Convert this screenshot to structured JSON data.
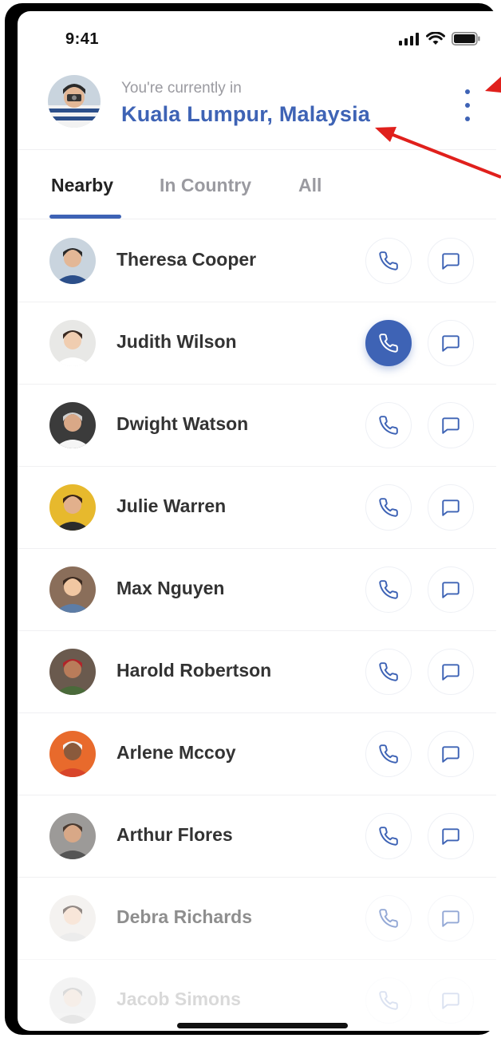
{
  "status": {
    "time": "9:41"
  },
  "header": {
    "subtitle": "You're currently in",
    "location": "Kuala Lumpur, Malaysia"
  },
  "tabs": [
    {
      "label": "Nearby",
      "active": true
    },
    {
      "label": "In Country",
      "active": false
    },
    {
      "label": "All",
      "active": false
    }
  ],
  "contacts": [
    {
      "name": "Theresa Cooper",
      "call_active": false
    },
    {
      "name": "Judith Wilson",
      "call_active": true
    },
    {
      "name": "Dwight Watson",
      "call_active": false
    },
    {
      "name": "Julie Warren",
      "call_active": false
    },
    {
      "name": "Max Nguyen",
      "call_active": false
    },
    {
      "name": "Harold Robertson",
      "call_active": false
    },
    {
      "name": "Arlene Mccoy",
      "call_active": false
    },
    {
      "name": "Arthur Flores",
      "call_active": false
    },
    {
      "name": "Debra Richards",
      "call_active": false
    },
    {
      "name": "Jacob Simons",
      "call_active": false
    }
  ],
  "icons": {
    "call": "phone-icon",
    "message": "message-icon",
    "more": "more-vertical-icon"
  },
  "colors": {
    "accent": "#3e63b5",
    "annotation": "#e0201c"
  }
}
